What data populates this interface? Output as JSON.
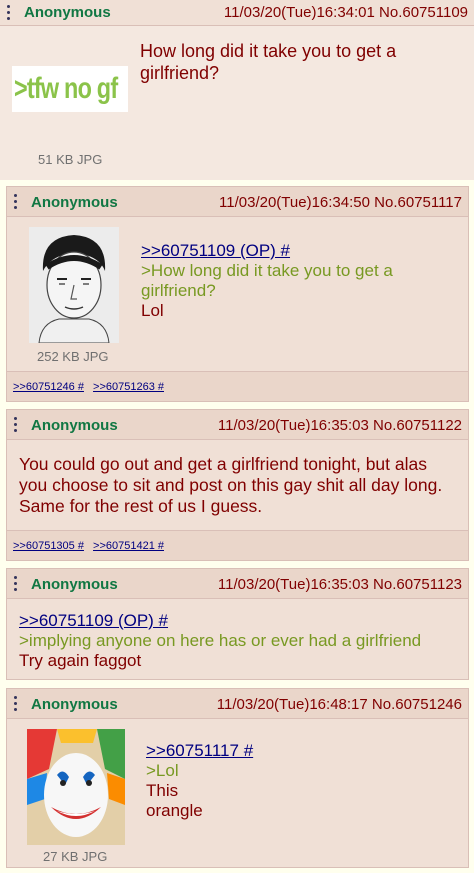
{
  "posts": [
    {
      "name": "Anonymous",
      "datetime": "11/03/20(Tue)16:34:01",
      "number": "No.60751109",
      "thumb_text": ">tfw no gf",
      "file_size": "51 KB JPG",
      "lines": [
        "How long did it take you to get a girlfriend?"
      ]
    },
    {
      "name": "Anonymous",
      "datetime": "11/03/20(Tue)16:34:50",
      "number": "No.60751117",
      "file_size": "252 KB JPG",
      "quote": ">>60751109 (OP) #",
      "greentext": ">How long did it take you to get a girlfriend?",
      "text": "Lol",
      "backlinks": [
        ">>60751246 #",
        ">>60751263 #"
      ]
    },
    {
      "name": "Anonymous",
      "datetime": "11/03/20(Tue)16:35:03",
      "number": "No.60751122",
      "text": "You could go out and get a girlfriend tonight, but alas you choose to sit and post on this gay shit all day long. Same for the rest of us I guess.",
      "backlinks": [
        ">>60751305 #",
        ">>60751421 #"
      ]
    },
    {
      "name": "Anonymous",
      "datetime": "11/03/20(Tue)16:35:03",
      "number": "No.60751123",
      "quote": ">>60751109 (OP) #",
      "greentext": ">implying anyone on here has or ever had a girlfriend",
      "text": "Try again faggot"
    },
    {
      "name": "Anonymous",
      "datetime": "11/03/20(Tue)16:48:17",
      "number": "No.60751246",
      "file_size": "27 KB JPG",
      "quote": ">>60751117 #",
      "greentext": ">Lol",
      "text1": "This",
      "text2": "orangle"
    }
  ]
}
